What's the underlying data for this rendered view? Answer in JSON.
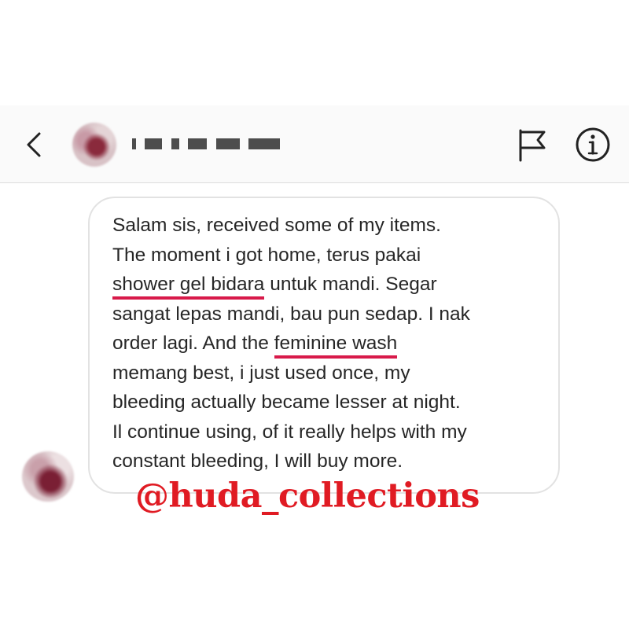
{
  "header": {
    "username_redacted": "i ▪▪ ▪ ▪▪ ▪▪",
    "icons": {
      "back": "chevron-left-icon",
      "report": "flag-icon",
      "info": "info-icon"
    }
  },
  "message": {
    "lines": [
      "Salam sis, received some of my items.",
      "The moment i got home, terus pakai",
      {
        "pre": "",
        "highlight": "shower gel bidara",
        "post": " untuk mandi. Segar"
      },
      "sangat lepas mandi, bau pun sedap. I nak",
      {
        "pre": "order lagi. And the ",
        "highlight": "feminine wash",
        "post": ""
      },
      "memang best, i just used once, my",
      "bleeding actually became lesser at night.",
      "Il continue using, of it really helps with my",
      "constant bleeding, I will buy more."
    ]
  },
  "watermark": "@huda_collections",
  "colors": {
    "highlight_underline": "#d81a4a",
    "watermark": "#e01b23",
    "text": "#262626",
    "bubble_border": "#e2e2e2"
  }
}
